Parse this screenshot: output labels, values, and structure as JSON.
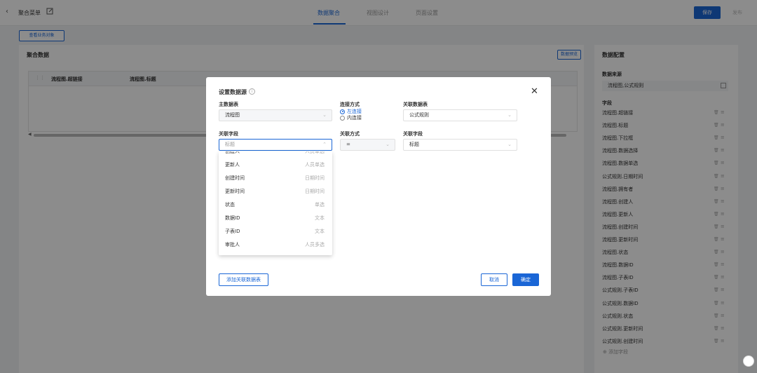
{
  "header": {
    "menu_title": "聚合菜单",
    "tabs": [
      {
        "label": "数据聚合",
        "active": true
      },
      {
        "label": "视图设计",
        "active": false
      },
      {
        "label": "页面设置",
        "active": false
      }
    ],
    "save_label": "保存",
    "publish_label": "发布"
  },
  "subbar": {
    "view_object_label": "查看业务对象"
  },
  "main": {
    "title": "聚合数据",
    "preview_label": "数据预览",
    "columns": [
      "流程图.超链接",
      "流程图.标题"
    ]
  },
  "right_panel": {
    "title": "数据配置",
    "source_label": "数据来源",
    "source_value": "流程图,公式规则",
    "fields_label": "字段",
    "fields": [
      "流程图.超链接",
      "流程图.标题",
      "流程图.下拉框",
      "流程图.数据选择",
      "流程图.数据单选",
      "公式规则.日期时间",
      "流程图.拥有者",
      "流程图.创建人",
      "流程图.更新人",
      "流程图.创建时间",
      "流程图.更新时间",
      "流程图.状态",
      "流程图.数据ID",
      "流程图.子表ID",
      "公式规则.子表ID",
      "公式规则.数据ID",
      "公式规则.状态",
      "公式规则.更新时间",
      "公式规则.创建时间"
    ],
    "add_field_label": "添加字段"
  },
  "modal": {
    "title": "设置数据源",
    "main_table_label": "主数据表",
    "main_table_value": "流程图",
    "join_type_label": "连接方式",
    "join_options": [
      {
        "label": "左连接",
        "checked": true
      },
      {
        "label": "内连接",
        "checked": false
      }
    ],
    "related_table_label": "关联数据表",
    "related_table_value": "公式规则",
    "related_field_label": "关联字段",
    "related_field_placeholder": "标题",
    "relation_label": "关联方式",
    "relation_value": "=",
    "target_field_label": "关联字段",
    "target_field_value": "标题",
    "dropdown_items": [
      {
        "name": "创建人",
        "type": "人员单选"
      },
      {
        "name": "更新人",
        "type": "人员单选"
      },
      {
        "name": "创建时间",
        "type": "日期时间"
      },
      {
        "name": "更新时间",
        "type": "日期时间"
      },
      {
        "name": "状态",
        "type": "单选"
      },
      {
        "name": "数据ID",
        "type": "文本"
      },
      {
        "name": "子表ID",
        "type": "文本"
      },
      {
        "name": "审批人",
        "type": "人员多选"
      }
    ],
    "add_related_label": "添加关联数据表",
    "cancel_label": "取消",
    "ok_label": "确定"
  }
}
